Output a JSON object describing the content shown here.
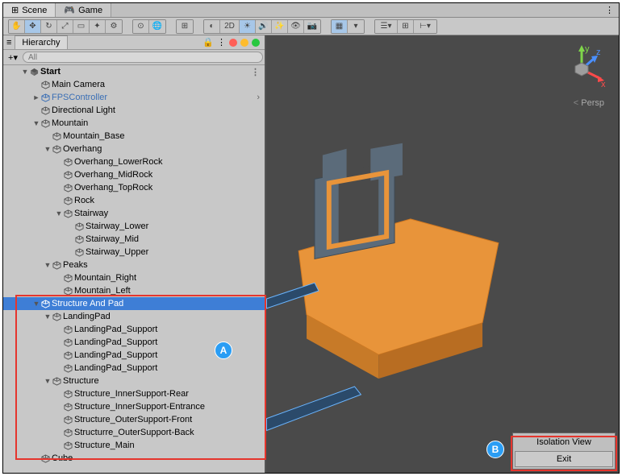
{
  "tabs": {
    "scene": "Scene",
    "game": "Game"
  },
  "toolbar": {
    "mode_2d": "2D"
  },
  "hierarchy": {
    "title": "Hierarchy",
    "search_placeholder": "All",
    "scene_label": "Start",
    "tree": [
      {
        "label": "Main Camera",
        "depth": 1,
        "arrow": ""
      },
      {
        "label": "FPSController",
        "depth": 1,
        "arrow": "►",
        "prefab": true,
        "chevron": true
      },
      {
        "label": "Directional Light",
        "depth": 1,
        "arrow": ""
      },
      {
        "label": "Mountain",
        "depth": 1,
        "arrow": "▼"
      },
      {
        "label": "Mountain_Base",
        "depth": 2,
        "arrow": ""
      },
      {
        "label": "Overhang",
        "depth": 2,
        "arrow": "▼"
      },
      {
        "label": "Overhang_LowerRock",
        "depth": 3,
        "arrow": ""
      },
      {
        "label": "Overhang_MidRock",
        "depth": 3,
        "arrow": ""
      },
      {
        "label": "Overhang_TopRock",
        "depth": 3,
        "arrow": ""
      },
      {
        "label": "Rock",
        "depth": 3,
        "arrow": ""
      },
      {
        "label": "Stairway",
        "depth": 3,
        "arrow": "▼"
      },
      {
        "label": "Stairway_Lower",
        "depth": 4,
        "arrow": ""
      },
      {
        "label": "Stairway_Mid",
        "depth": 4,
        "arrow": ""
      },
      {
        "label": "Stairway_Upper",
        "depth": 4,
        "arrow": ""
      },
      {
        "label": "Peaks",
        "depth": 2,
        "arrow": "▼"
      },
      {
        "label": "Mountain_Right",
        "depth": 3,
        "arrow": ""
      },
      {
        "label": "Mountain_Left",
        "depth": 3,
        "arrow": ""
      },
      {
        "label": "Structure And Pad",
        "depth": 1,
        "arrow": "▼",
        "selected": true
      },
      {
        "label": "LandingPad",
        "depth": 2,
        "arrow": "▼"
      },
      {
        "label": "LandingPad_Support",
        "depth": 3,
        "arrow": ""
      },
      {
        "label": "LandingPad_Support",
        "depth": 3,
        "arrow": ""
      },
      {
        "label": "LandingPad_Support",
        "depth": 3,
        "arrow": ""
      },
      {
        "label": "LandingPad_Support",
        "depth": 3,
        "arrow": ""
      },
      {
        "label": "Structure",
        "depth": 2,
        "arrow": "▼"
      },
      {
        "label": "Structure_InnerSupport-Rear",
        "depth": 3,
        "arrow": ""
      },
      {
        "label": "Structure_InnerSupport-Entrance",
        "depth": 3,
        "arrow": ""
      },
      {
        "label": "Structure_OuterSupport-Front",
        "depth": 3,
        "arrow": ""
      },
      {
        "label": "Structurre_OuterSupport-Back",
        "depth": 3,
        "arrow": ""
      },
      {
        "label": "Structure_Main",
        "depth": 3,
        "arrow": ""
      },
      {
        "label": "Cube",
        "depth": 1,
        "arrow": ""
      }
    ]
  },
  "viewport": {
    "projection": "Persp",
    "isolation_title": "Isolation View",
    "isolation_exit": "Exit",
    "axis": {
      "x": "x",
      "y": "y",
      "z": "z"
    }
  },
  "callouts": {
    "a": "A",
    "b": "B"
  },
  "colors": {
    "selected": "#3e7ed6",
    "prefab": "#3b6fb5",
    "highlight": "#e5352d",
    "callout": "#2a9df4",
    "mesh_orange": "#e8943a",
    "mesh_gray": "#5b6b7a"
  }
}
